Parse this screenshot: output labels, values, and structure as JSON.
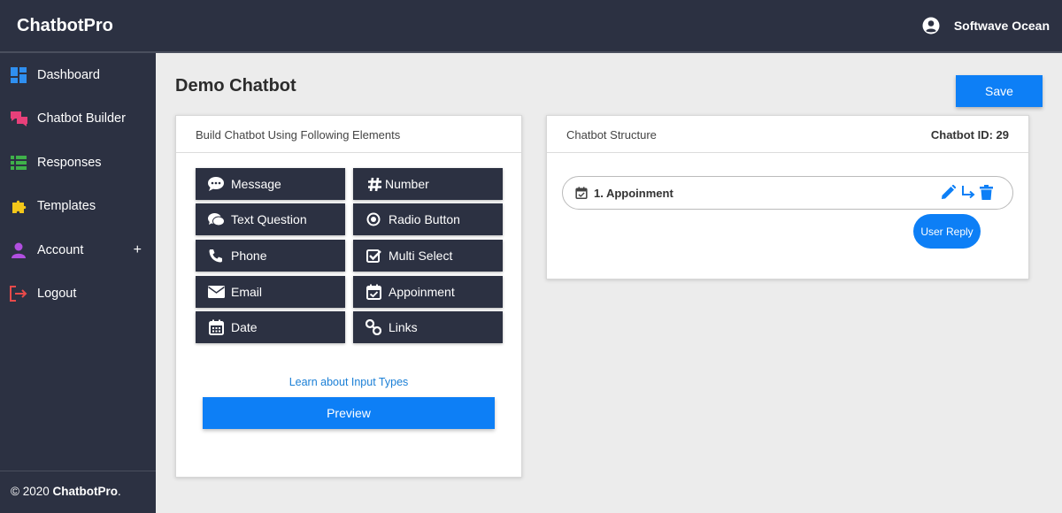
{
  "app": {
    "brand": "ChatbotPro",
    "user_name": "Softwave Ocean"
  },
  "sidebar": {
    "items": [
      {
        "label": "Dashboard",
        "icon": "dashboard-icon"
      },
      {
        "label": "Chatbot Builder",
        "icon": "chat-bubbles-icon"
      },
      {
        "label": "Responses",
        "icon": "list-icon"
      },
      {
        "label": "Templates",
        "icon": "puzzle-icon"
      },
      {
        "label": "Account",
        "icon": "user-icon",
        "expand": "+"
      },
      {
        "label": "Logout",
        "icon": "logout-icon"
      }
    ],
    "copyright_prefix": "© 2020",
    "copyright_brand": "ChatbotPro",
    "copyright_suffix": "."
  },
  "page": {
    "title": "Demo Chatbot",
    "save_label": "Save"
  },
  "builder": {
    "header": "Build Chatbot Using Following Elements",
    "elements": [
      {
        "label": "Message",
        "icon": "comment-icon"
      },
      {
        "label": "Number",
        "icon": "hashtag-icon"
      },
      {
        "label": "Text Question",
        "icon": "comments-icon"
      },
      {
        "label": "Radio Button",
        "icon": "radio-icon"
      },
      {
        "label": "Phone",
        "icon": "phone-icon"
      },
      {
        "label": "Multi Select",
        "icon": "checkbox-icon"
      },
      {
        "label": "Email",
        "icon": "envelope-icon"
      },
      {
        "label": "Appoinment",
        "icon": "calendar-check-icon"
      },
      {
        "label": "Date",
        "icon": "calendar-icon"
      },
      {
        "label": "Links",
        "icon": "link-icon"
      }
    ],
    "learn_link": "Learn about Input Types",
    "preview_label": "Preview"
  },
  "structure": {
    "header": "Chatbot Structure",
    "chatbot_id_label": "Chatbot ID: 29",
    "nodes": [
      {
        "title": "1. Appoinment",
        "icon": "calendar-check-icon"
      }
    ],
    "reply_label": "User Reply",
    "action_icons": [
      "edit-icon",
      "branch-arrow-icon",
      "trash-icon"
    ]
  },
  "colors": {
    "primary": "#0d7ff6",
    "dark": "#2c3142",
    "background": "#ececec"
  }
}
